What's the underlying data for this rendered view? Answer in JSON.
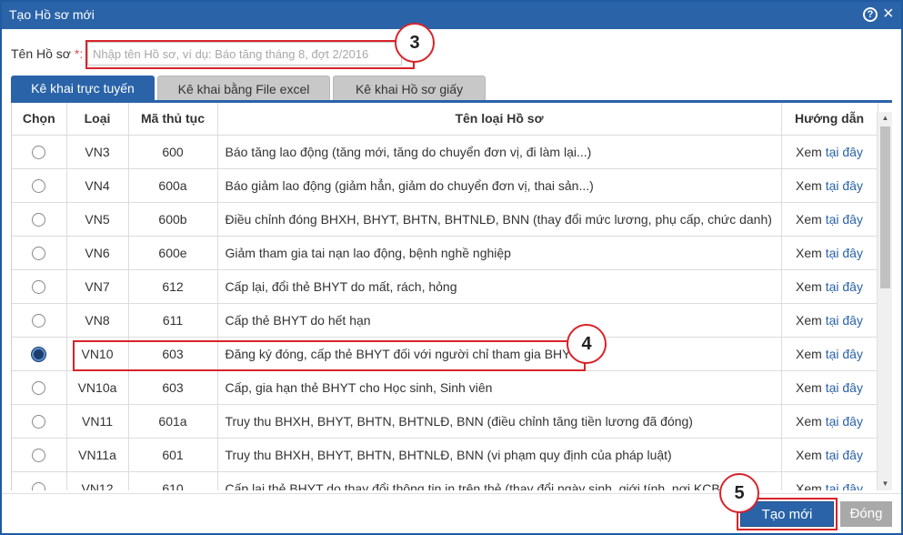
{
  "dialog": {
    "title": "Tạo Hồ sơ mới",
    "help_icon": "question-circle-icon",
    "close_icon": "close-icon"
  },
  "form": {
    "name_label": "Tên Hồ sơ",
    "required_mark": "*:",
    "name_placeholder": "Nhập tên Hồ sơ, ví dụ: Báo tăng tháng 8, đợt 2/2016",
    "name_value": ""
  },
  "tabs": [
    {
      "label": "Kê khai trực tuyến",
      "active": true
    },
    {
      "label": "Kê khai bằng File excel",
      "active": false
    },
    {
      "label": "Kê khai Hồ sơ giấy",
      "active": false
    }
  ],
  "table": {
    "headers": [
      "Chọn",
      "Loại",
      "Mã thủ tục",
      "Tên loại Hồ sơ",
      "Hướng dẫn"
    ],
    "rows": [
      {
        "selected": false,
        "type": "VN3",
        "code": "600",
        "name": "Báo tăng lao động (tăng mới, tăng do chuyển đơn vị, đi làm lại...)",
        "guide_pre": "Xem",
        "guide_link": "tại đây"
      },
      {
        "selected": false,
        "type": "VN4",
        "code": "600a",
        "name": "Báo giảm lao động (giảm hẳn, giảm do chuyển đơn vị, thai sản...)",
        "guide_pre": "Xem",
        "guide_link": "tại đây"
      },
      {
        "selected": false,
        "type": "VN5",
        "code": "600b",
        "name": "Điều chỉnh đóng BHXH, BHYT, BHTN, BHTNLĐ, BNN (thay đổi mức lương, phụ cấp, chức danh)",
        "guide_pre": "Xem",
        "guide_link": "tại đây"
      },
      {
        "selected": false,
        "type": "VN6",
        "code": "600e",
        "name": "Giảm tham gia tai nạn lao động, bệnh nghề nghiệp",
        "guide_pre": "Xem",
        "guide_link": "tại đây"
      },
      {
        "selected": false,
        "type": "VN7",
        "code": "612",
        "name": "Cấp lại, đổi thẻ BHYT do mất, rách, hỏng",
        "guide_pre": "Xem",
        "guide_link": "tại đây"
      },
      {
        "selected": false,
        "type": "VN8",
        "code": "611",
        "name": "Cấp thẻ BHYT do hết hạn",
        "guide_pre": "Xem",
        "guide_link": "tại đây"
      },
      {
        "selected": true,
        "type": "VN10",
        "code": "603",
        "name": "Đăng ký đóng, cấp thẻ BHYT đối với người chỉ tham gia BHYT",
        "guide_pre": "Xem",
        "guide_link": "tại đây"
      },
      {
        "selected": false,
        "type": "VN10a",
        "code": "603",
        "name": "Cấp, gia hạn thẻ BHYT cho Học sinh, Sinh viên",
        "guide_pre": "Xem",
        "guide_link": "tại đây"
      },
      {
        "selected": false,
        "type": "VN11",
        "code": "601a",
        "name": "Truy thu BHXH, BHYT, BHTN, BHTNLĐ, BNN (điều chỉnh tăng tiền lương đã đóng)",
        "guide_pre": "Xem",
        "guide_link": "tại đây"
      },
      {
        "selected": false,
        "type": "VN11a",
        "code": "601",
        "name": "Truy thu BHXH, BHYT, BHTN, BHTNLĐ, BNN (vi phạm quy định của pháp luật)",
        "guide_pre": "Xem",
        "guide_link": "tại đây"
      },
      {
        "selected": false,
        "type": "VN12",
        "code": "610",
        "name": "Cấp lại thẻ BHYT do thay đổi thông tin in trên thẻ (thay đổi ngày sinh, giới tính, nơi KCB",
        "guide_pre": "Xem",
        "guide_link": "tại đây"
      }
    ]
  },
  "footer": {
    "create_label": "Tạo mới",
    "close_label": "Đóng"
  },
  "callouts": [
    "3",
    "4",
    "5"
  ],
  "colors": {
    "primary": "#2a63a8",
    "highlight": "#d8232a",
    "disabled": "#a9a9a9"
  }
}
